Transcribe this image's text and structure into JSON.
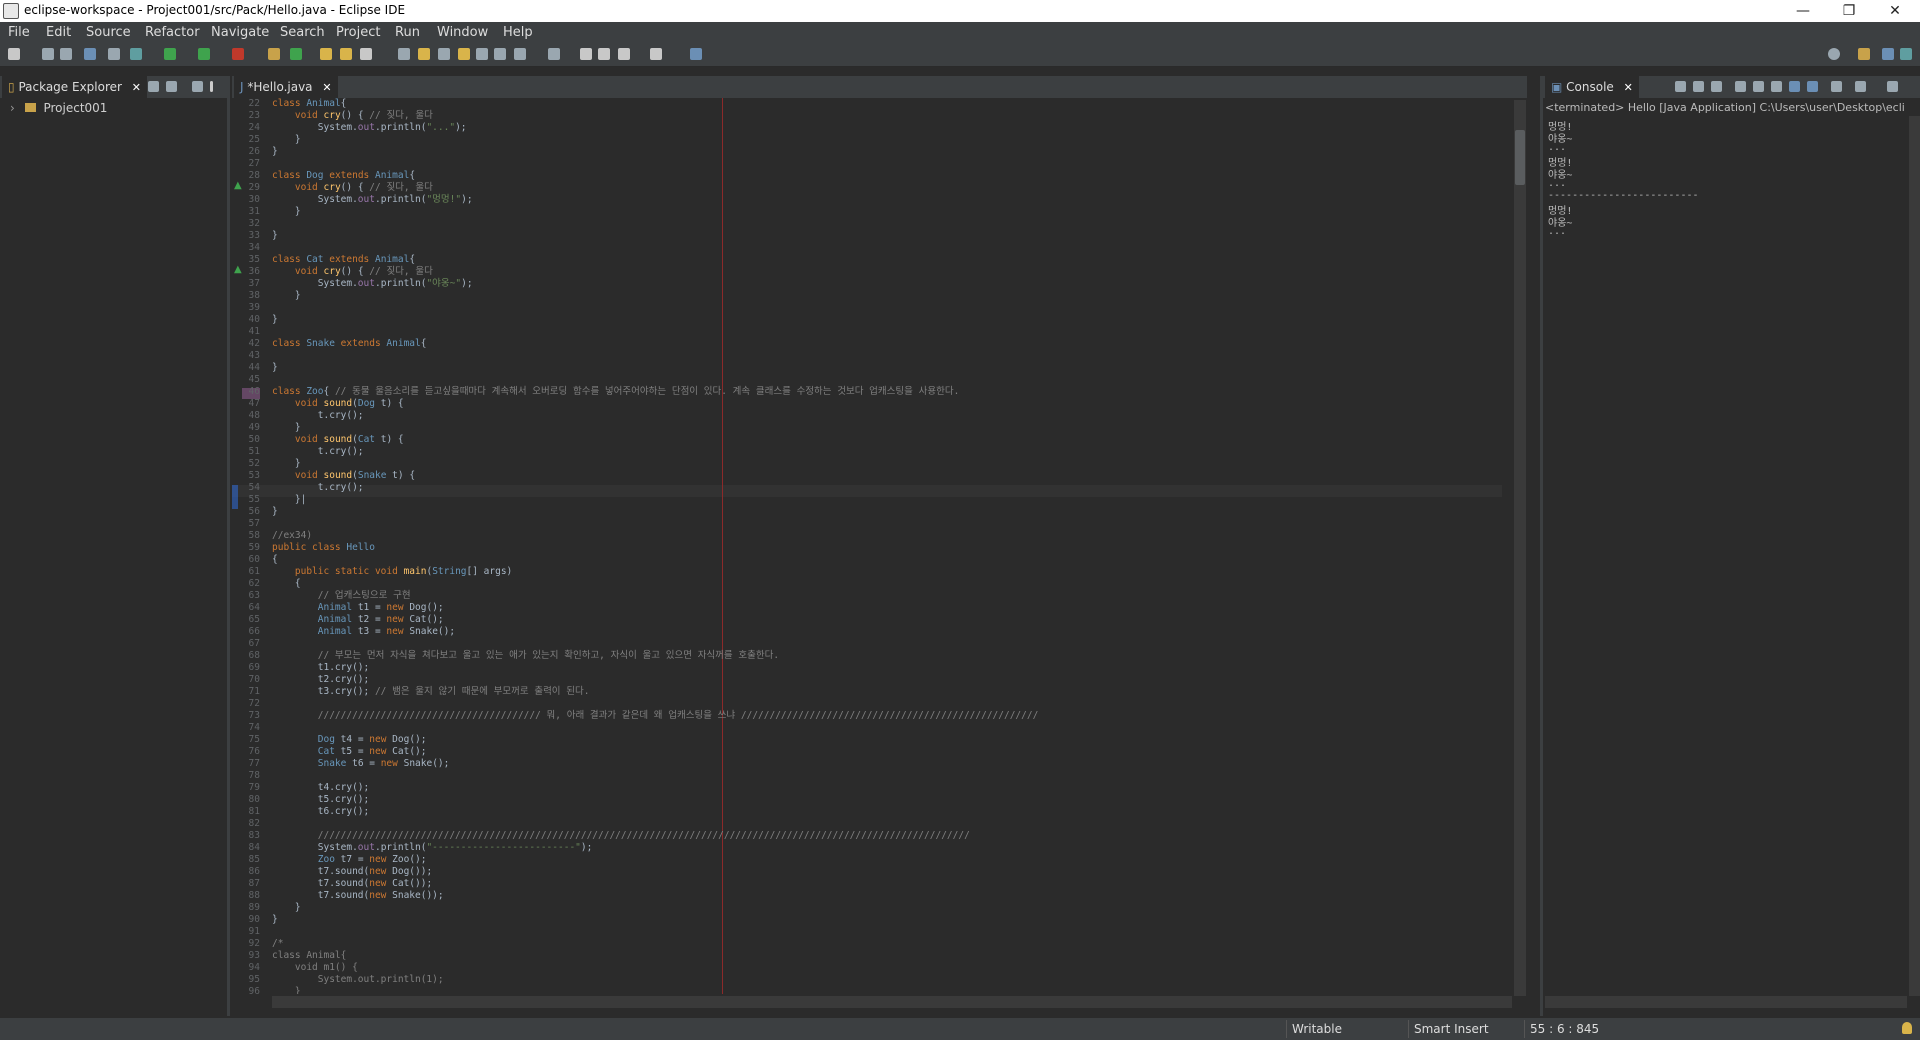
{
  "window": {
    "title": "eclipse-workspace - Project001/src/Pack/Hello.java - Eclipse IDE",
    "minimize": "—",
    "restore": "❐",
    "close": "✕"
  },
  "menu": [
    "File",
    "Edit",
    "Source",
    "Refactor",
    "Navigate",
    "Search",
    "Project",
    "Run",
    "Window",
    "Help"
  ],
  "package_explorer": {
    "tab_label": "Package Explorer",
    "project": "Project001",
    "expander": "›"
  },
  "editor": {
    "tab_label": "*Hello.java",
    "lines": [
      {
        "n": "22",
        "segs": [
          [
            "kw",
            "class "
          ],
          [
            "cls",
            "Animal"
          ],
          [
            "",
            "{"
          ]
        ]
      },
      {
        "n": "23",
        "segs": [
          [
            "",
            "    "
          ],
          [
            "kw",
            "void "
          ],
          [
            "mth",
            "cry"
          ],
          [
            "",
            "() { "
          ],
          [
            "cm",
            "// 짖다, 울다"
          ]
        ]
      },
      {
        "n": "24",
        "segs": [
          [
            "",
            "        System."
          ],
          [
            "fld",
            "out"
          ],
          [
            "",
            ".println("
          ],
          [
            "str",
            "\"...\""
          ],
          [
            "",
            ");"
          ]
        ]
      },
      {
        "n": "25",
        "segs": [
          [
            "",
            "    }"
          ]
        ]
      },
      {
        "n": "26",
        "segs": [
          [
            "",
            "}"
          ]
        ]
      },
      {
        "n": "27",
        "segs": []
      },
      {
        "n": "28",
        "segs": [
          [
            "kw",
            "class "
          ],
          [
            "cls",
            "Dog "
          ],
          [
            "kw",
            "extends "
          ],
          [
            "cls",
            "Animal"
          ],
          [
            "",
            "{"
          ]
        ]
      },
      {
        "n": "29",
        "segs": [
          [
            "",
            "    "
          ],
          [
            "kw",
            "void "
          ],
          [
            "mth",
            "cry"
          ],
          [
            "",
            "() { "
          ],
          [
            "cm",
            "// 짖다, 울다"
          ]
        ]
      },
      {
        "n": "30",
        "segs": [
          [
            "",
            "        System."
          ],
          [
            "fld",
            "out"
          ],
          [
            "",
            ".println("
          ],
          [
            "str",
            "\"멍멍!\""
          ],
          [
            "",
            ");"
          ]
        ]
      },
      {
        "n": "31",
        "segs": [
          [
            "",
            "    }"
          ]
        ]
      },
      {
        "n": "32",
        "segs": []
      },
      {
        "n": "33",
        "segs": [
          [
            "",
            "}"
          ]
        ]
      },
      {
        "n": "34",
        "segs": []
      },
      {
        "n": "35",
        "segs": [
          [
            "kw",
            "class "
          ],
          [
            "cls",
            "Cat "
          ],
          [
            "kw",
            "extends "
          ],
          [
            "cls",
            "Animal"
          ],
          [
            "",
            "{"
          ]
        ]
      },
      {
        "n": "36",
        "segs": [
          [
            "",
            "    "
          ],
          [
            "kw",
            "void "
          ],
          [
            "mth",
            "cry"
          ],
          [
            "",
            "() { "
          ],
          [
            "cm",
            "// 짖다, 울다"
          ]
        ]
      },
      {
        "n": "37",
        "segs": [
          [
            "",
            "        System."
          ],
          [
            "fld",
            "out"
          ],
          [
            "",
            ".println("
          ],
          [
            "str",
            "\"야옹~\""
          ],
          [
            "",
            ");"
          ]
        ]
      },
      {
        "n": "38",
        "segs": [
          [
            "",
            "    }"
          ]
        ]
      },
      {
        "n": "39",
        "segs": []
      },
      {
        "n": "40",
        "segs": [
          [
            "",
            "}"
          ]
        ]
      },
      {
        "n": "41",
        "segs": []
      },
      {
        "n": "42",
        "segs": [
          [
            "kw",
            "class "
          ],
          [
            "cls",
            "Snake "
          ],
          [
            "kw",
            "extends "
          ],
          [
            "cls",
            "Animal"
          ],
          [
            "",
            "{"
          ]
        ]
      },
      {
        "n": "43",
        "segs": []
      },
      {
        "n": "44",
        "segs": [
          [
            "",
            "}"
          ]
        ]
      },
      {
        "n": "45",
        "segs": []
      },
      {
        "n": "46",
        "segs": [
          [
            "kw",
            "class "
          ],
          [
            "cls",
            "Zoo"
          ],
          [
            "",
            "{ "
          ],
          [
            "cm",
            "// 동물 울음소리를 듣고싶을때마다 계속해서 오버로딩 함수를 넣어주어야하는 단점이 있다. 계속 클래스를 수정하는 것보다 업캐스팅을 사용한다."
          ]
        ]
      },
      {
        "n": "47",
        "segs": [
          [
            "",
            "    "
          ],
          [
            "kw",
            "void "
          ],
          [
            "mth",
            "sound"
          ],
          [
            "",
            "("
          ],
          [
            "cls",
            "Dog "
          ],
          [
            "",
            "t) {"
          ]
        ]
      },
      {
        "n": "48",
        "segs": [
          [
            "",
            "        t.cry();"
          ]
        ]
      },
      {
        "n": "49",
        "segs": [
          [
            "",
            "    }"
          ]
        ]
      },
      {
        "n": "50",
        "segs": [
          [
            "",
            "    "
          ],
          [
            "kw",
            "void "
          ],
          [
            "mth",
            "sound"
          ],
          [
            "",
            "("
          ],
          [
            "cls",
            "Cat "
          ],
          [
            "",
            "t) {"
          ]
        ]
      },
      {
        "n": "51",
        "segs": [
          [
            "",
            "        t.cry();"
          ]
        ]
      },
      {
        "n": "52",
        "segs": [
          [
            "",
            "    }"
          ]
        ]
      },
      {
        "n": "53",
        "segs": [
          [
            "",
            "    "
          ],
          [
            "kw",
            "void "
          ],
          [
            "mth",
            "sound"
          ],
          [
            "",
            "("
          ],
          [
            "cls",
            "Snake "
          ],
          [
            "",
            "t) {"
          ]
        ]
      },
      {
        "n": "54",
        "segs": [
          [
            "",
            "        t.cry();"
          ]
        ]
      },
      {
        "n": "55",
        "segs": [
          [
            "",
            "    }|"
          ]
        ]
      },
      {
        "n": "56",
        "segs": [
          [
            "",
            "}"
          ]
        ]
      },
      {
        "n": "57",
        "segs": []
      },
      {
        "n": "58",
        "segs": [
          [
            "cm",
            "//ex34)"
          ]
        ]
      },
      {
        "n": "59",
        "segs": [
          [
            "kw",
            "public class "
          ],
          [
            "cls",
            "Hello"
          ]
        ]
      },
      {
        "n": "60",
        "segs": [
          [
            "",
            "{"
          ]
        ]
      },
      {
        "n": "61",
        "segs": [
          [
            "",
            "    "
          ],
          [
            "kw",
            "public static void "
          ],
          [
            "mth",
            "main"
          ],
          [
            "",
            "("
          ],
          [
            "cls",
            "String"
          ],
          [
            "",
            "[] args)"
          ]
        ]
      },
      {
        "n": "62",
        "segs": [
          [
            "",
            "    {"
          ]
        ]
      },
      {
        "n": "63",
        "segs": [
          [
            "",
            "        "
          ],
          [
            "cm",
            "// 업캐스팅으로 구현"
          ]
        ]
      },
      {
        "n": "64",
        "segs": [
          [
            "",
            "        "
          ],
          [
            "cls",
            "Animal "
          ],
          [
            "",
            "t1 = "
          ],
          [
            "kw",
            "new "
          ],
          [
            "",
            "Dog();"
          ]
        ]
      },
      {
        "n": "65",
        "segs": [
          [
            "",
            "        "
          ],
          [
            "cls",
            "Animal "
          ],
          [
            "",
            "t2 = "
          ],
          [
            "kw",
            "new "
          ],
          [
            "",
            "Cat();"
          ]
        ]
      },
      {
        "n": "66",
        "segs": [
          [
            "",
            "        "
          ],
          [
            "cls",
            "Animal "
          ],
          [
            "",
            "t3 = "
          ],
          [
            "kw",
            "new "
          ],
          [
            "",
            "Snake();"
          ]
        ]
      },
      {
        "n": "67",
        "segs": []
      },
      {
        "n": "68",
        "segs": [
          [
            "",
            "        "
          ],
          [
            "cm",
            "// 부모는 먼저 자식을 쳐다보고 울고 있는 애가 있는지 확인하고, 자식이 울고 있으면 자식꺼를 호출한다."
          ]
        ]
      },
      {
        "n": "69",
        "segs": [
          [
            "",
            "        t1.cry();"
          ]
        ]
      },
      {
        "n": "70",
        "segs": [
          [
            "",
            "        t2.cry();"
          ]
        ]
      },
      {
        "n": "71",
        "segs": [
          [
            "",
            "        t3.cry(); "
          ],
          [
            "cm",
            "// 뱀은 울지 않기 때문에 부모꺼로 출력이 된다."
          ]
        ]
      },
      {
        "n": "72",
        "segs": []
      },
      {
        "n": "73",
        "segs": [
          [
            "",
            "        "
          ],
          [
            "cm",
            "/////////////////////////////////////// 뭐, 아래 결과가 같은데 왜 업캐스팅을 쓰냐 ////////////////////////////////////////////////////"
          ]
        ]
      },
      {
        "n": "74",
        "segs": []
      },
      {
        "n": "75",
        "segs": [
          [
            "",
            "        "
          ],
          [
            "cls",
            "Dog "
          ],
          [
            "",
            "t4 = "
          ],
          [
            "kw",
            "new "
          ],
          [
            "",
            "Dog();"
          ]
        ]
      },
      {
        "n": "76",
        "segs": [
          [
            "",
            "        "
          ],
          [
            "cls",
            "Cat "
          ],
          [
            "",
            "t5 = "
          ],
          [
            "kw",
            "new "
          ],
          [
            "",
            "Cat();"
          ]
        ]
      },
      {
        "n": "77",
        "segs": [
          [
            "",
            "        "
          ],
          [
            "cls",
            "Snake "
          ],
          [
            "",
            "t6 = "
          ],
          [
            "kw",
            "new "
          ],
          [
            "",
            "Snake();"
          ]
        ]
      },
      {
        "n": "78",
        "segs": []
      },
      {
        "n": "79",
        "segs": [
          [
            "",
            "        t4.cry();"
          ]
        ]
      },
      {
        "n": "80",
        "segs": [
          [
            "",
            "        t5.cry();"
          ]
        ]
      },
      {
        "n": "81",
        "segs": [
          [
            "",
            "        t6.cry();"
          ]
        ]
      },
      {
        "n": "82",
        "segs": []
      },
      {
        "n": "83",
        "segs": [
          [
            "",
            "        "
          ],
          [
            "cm",
            "//////////////////////////////////////////////////////////////////////////////////////////////////////////////////"
          ]
        ]
      },
      {
        "n": "84",
        "segs": [
          [
            "",
            "        System."
          ],
          [
            "fld",
            "out"
          ],
          [
            "",
            ".println("
          ],
          [
            "str",
            "\"-------------------------\""
          ],
          [
            "",
            ");"
          ]
        ]
      },
      {
        "n": "85",
        "segs": [
          [
            "",
            "        "
          ],
          [
            "cls",
            "Zoo "
          ],
          [
            "",
            "t7 = "
          ],
          [
            "kw",
            "new "
          ],
          [
            "",
            "Zoo();"
          ]
        ]
      },
      {
        "n": "86",
        "segs": [
          [
            "",
            "        t7.sound("
          ],
          [
            "kw",
            "new "
          ],
          [
            "",
            "Dog());"
          ]
        ]
      },
      {
        "n": "87",
        "segs": [
          [
            "",
            "        t7.sound("
          ],
          [
            "kw",
            "new "
          ],
          [
            "",
            "Cat());"
          ]
        ]
      },
      {
        "n": "88",
        "segs": [
          [
            "",
            "        t7.sound("
          ],
          [
            "kw",
            "new "
          ],
          [
            "",
            "Snake());"
          ]
        ]
      },
      {
        "n": "89",
        "segs": [
          [
            "",
            "    }"
          ]
        ]
      },
      {
        "n": "90",
        "segs": [
          [
            "",
            "}"
          ]
        ]
      },
      {
        "n": "91",
        "segs": []
      },
      {
        "n": "92",
        "segs": [
          [
            "cm",
            "/*"
          ]
        ]
      },
      {
        "n": "93",
        "segs": [
          [
            "cm",
            "class Animal{"
          ]
        ]
      },
      {
        "n": "94",
        "segs": [
          [
            "cm",
            "    void m1() {"
          ]
        ]
      },
      {
        "n": "95",
        "segs": [
          [
            "cm",
            "        System.out.println(1);"
          ]
        ]
      },
      {
        "n": "96",
        "segs": [
          [
            "cm",
            "    }"
          ]
        ]
      }
    ]
  },
  "console": {
    "tab_label": "Console",
    "header": "<terminated> Hello [Java Application] C:\\Users\\user\\Desktop\\ecli",
    "lines": [
      "멍멍!",
      "야옹~",
      "...",
      "멍멍!",
      "야옹~",
      "...",
      "-------------------------",
      "멍멍!",
      "야옹~",
      "..."
    ]
  },
  "status": {
    "writable": "Writable",
    "insert_mode": "Smart Insert",
    "position": "55 : 6 : 845"
  }
}
